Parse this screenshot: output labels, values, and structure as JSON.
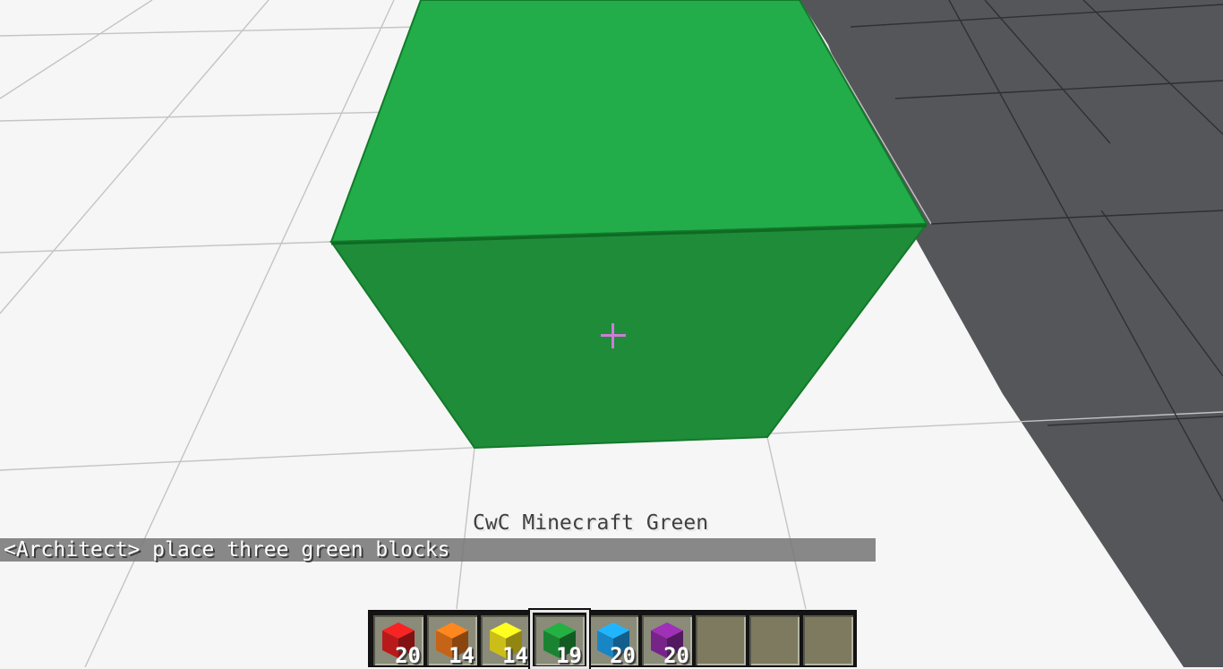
{
  "hud": {
    "held_item_name": "CwC Minecraft Green",
    "chat_message": "<Architect> place three green blocks",
    "selected_slot": 3,
    "crosshair_color": "#d17ad8"
  },
  "hotbar": {
    "slots": [
      {
        "block": "red-block",
        "color": "#d81e1e",
        "count": "20"
      },
      {
        "block": "orange-block",
        "color": "#e8751a",
        "count": "14"
      },
      {
        "block": "yellow-block",
        "color": "#f0e01c",
        "count": "14"
      },
      {
        "block": "green-block",
        "color": "#1e9a3a",
        "count": "19"
      },
      {
        "block": "blue-block",
        "color": "#1c9ee6",
        "count": "20"
      },
      {
        "block": "purple-block",
        "color": "#8b2aa0",
        "count": "20"
      },
      {
        "block": "empty",
        "color": "",
        "count": ""
      },
      {
        "block": "empty",
        "color": "",
        "count": ""
      },
      {
        "block": "empty",
        "color": "",
        "count": ""
      }
    ]
  },
  "world": {
    "floor_color": "#f6f6f6",
    "grid_color": "#bdbdbd",
    "dark_floor_color": "#55565a",
    "block_top_color": "#22ad4a",
    "block_front_color": "#1f8c3a",
    "block_edge_color": "#137a2a"
  }
}
